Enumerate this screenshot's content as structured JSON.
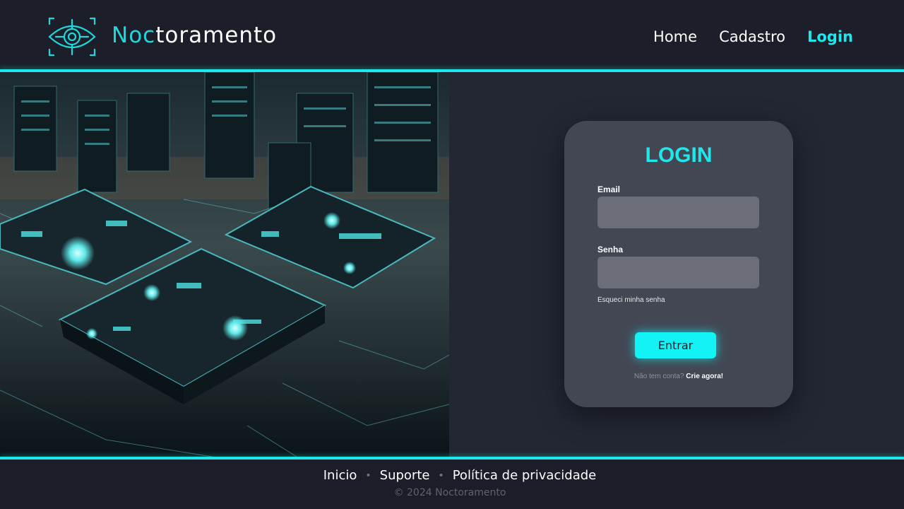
{
  "brand": {
    "name_part1": "Noc",
    "name_part2": "toramento",
    "icon": "eye-scan-icon"
  },
  "nav": {
    "items": [
      {
        "label": "Home",
        "active": false
      },
      {
        "label": "Cadastro",
        "active": false
      },
      {
        "label": "Login",
        "active": true
      }
    ]
  },
  "hero": {
    "image": "circuit-city-illustration"
  },
  "login": {
    "title": "LOGIN",
    "email_label": "Email",
    "email_value": "",
    "password_label": "Senha",
    "password_value": "",
    "forgot_label": "Esqueci minha senha",
    "submit_label": "Entrar",
    "signup_question": "Não tem conta?",
    "signup_link": "Crie agora!"
  },
  "footer": {
    "links": [
      "Inicio",
      "Suporte",
      "Política de privacidade"
    ],
    "separator": "•",
    "copyright": "© 2024 Noctoramento"
  },
  "colors": {
    "accent": "#1ee8ec",
    "background": "#1b1e28",
    "panel": "#232734",
    "card": "#434754",
    "input": "#6b6e79"
  }
}
